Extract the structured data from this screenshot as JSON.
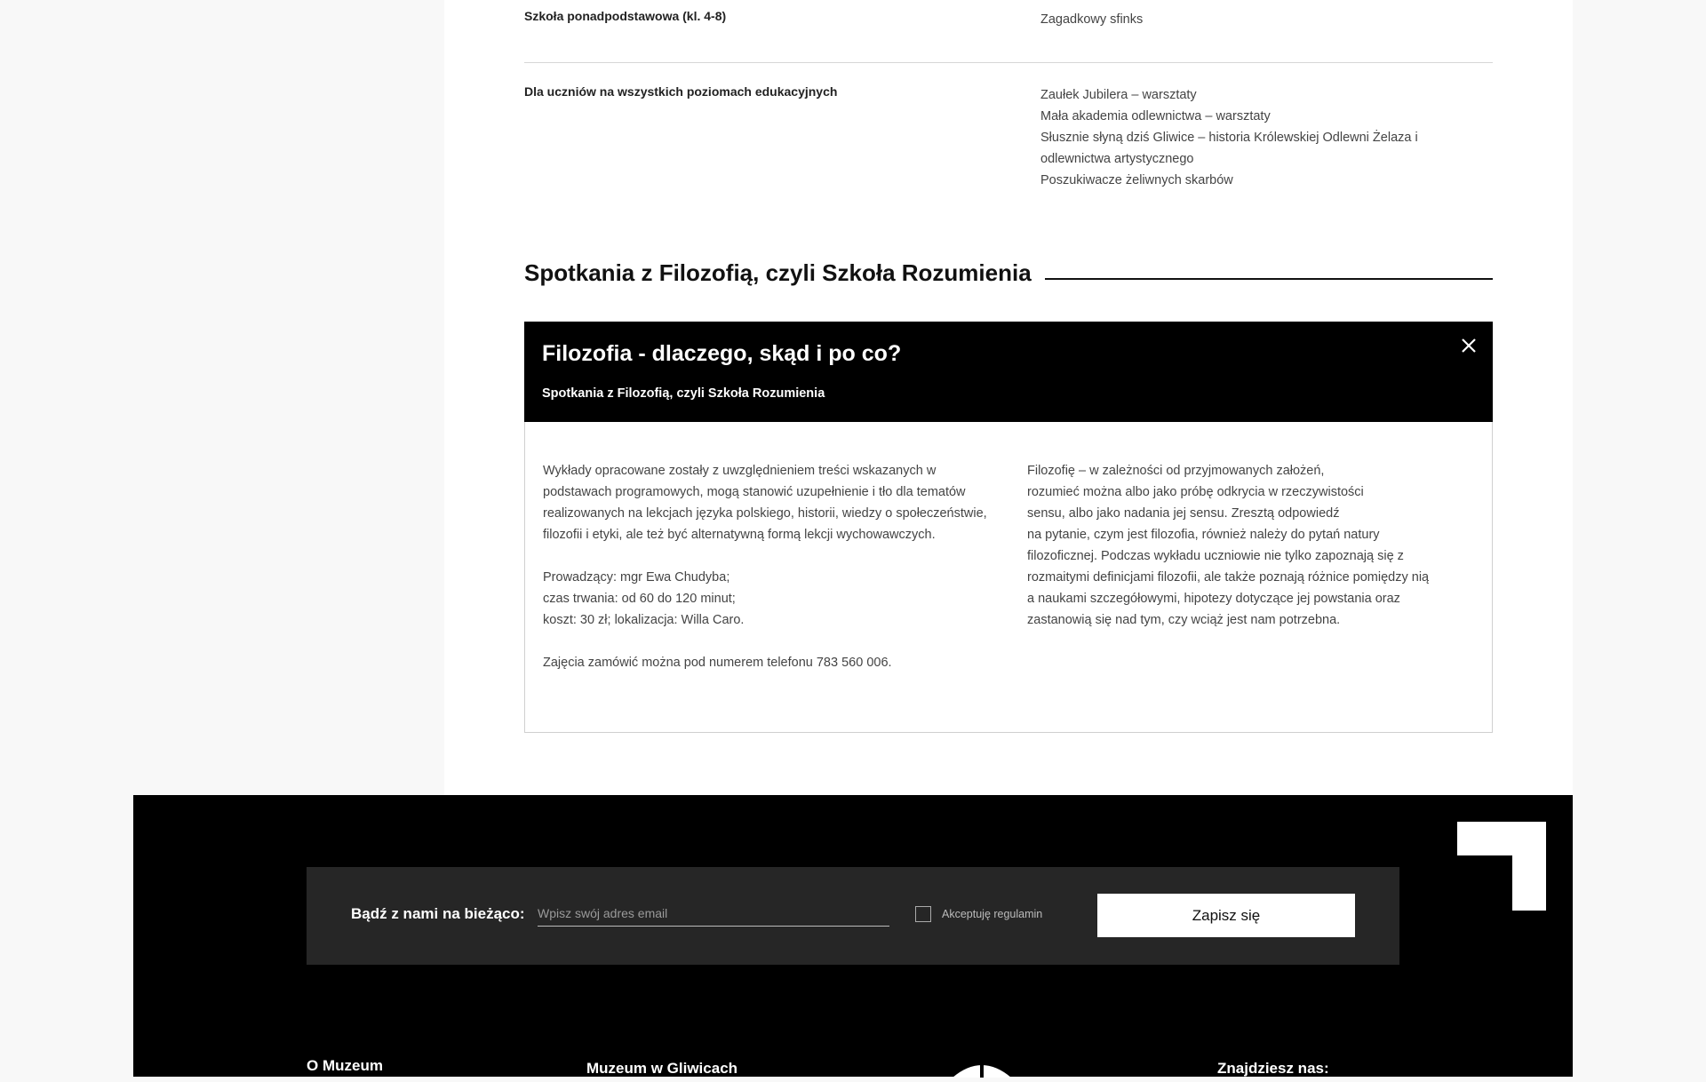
{
  "education_rows": [
    {
      "level": "Szkoła ponadpodstawowa (kl. 4-8)",
      "items": [
        "Zagadkowy sfinks"
      ]
    },
    {
      "level": "Dla uczniów na wszystkich poziomach edukacyjnych",
      "items": [
        "Zaułek Jubilera – warsztaty",
        "Mała akademia odlewnictwa – warsztaty",
        "Słusznie słyną dziś Gliwice – historia Królewskiej Odlewni Żelaza i odlewnictwa artystycznego",
        "Poszukiwacze żeliwnych skarbów"
      ]
    }
  ],
  "section": {
    "title": "Spotkania z Filozofią, czyli Szkoła Rozumienia"
  },
  "card": {
    "title": "Filozofia - dlaczego, skąd i po co?",
    "subtitle": "Spotkania z Filozofią, czyli Szkoła Rozumienia",
    "left_paragraphs": [
      "Wykłady opracowane zostały z uwzględnieniem treści wskazanych w podstawach programowych, mogą stanowić uzupełnienie i tło dla tematów realizowanych na lekcjach języka polskiego, historii, wiedzy o społeczeństwie, filozofii i etyki, ale też być alternatywną formą lekcji wychowawczych."
    ],
    "details": [
      "Prowadzący: mgr Ewa Chudyba;",
      "czas trwania: od 60 do 120 minut;",
      "koszt: 30 zł; lokalizacja: Willa Caro."
    ],
    "contact": "Zajęcia zamówić można pod numerem telefonu 783 560 006.",
    "right_lines": [
      "Filozofię – w zależności od przyjmowanych założeń,",
      "rozumieć można albo jako próbę odkrycia w rzeczywistości",
      "sensu, albo jako nadania jej sensu. Zresztą odpowiedź",
      "na pytanie, czym jest filozofia, również należy do pytań natury",
      "filozoficznej. Podczas wykładu uczniowie nie tylko zapoznają się z",
      "rozmaitymi definicjami filozofii, ale także poznają różnice pomiędzy nią",
      "a naukami szczegółowymi, hipotezy dotyczące jej powstania oraz",
      "zastanowią się nad tym, czy wciąż jest nam potrzebna."
    ],
    "close_icon": "close-icon"
  },
  "newsletter": {
    "label": "Bądź z nami na bieżąco:",
    "email_placeholder": "Wpisz swój adres email",
    "email_value": "",
    "terms_label": "Akceptuję regulamin",
    "terms_checked": false,
    "submit_label": "Zapisz się"
  },
  "footer": {
    "col1": "O Muzeum",
    "col2": "Muzeum w Gliwicach",
    "col4": "Znajdziesz nas:"
  },
  "colors": {
    "page_bg": "#f8f8f8",
    "footer_bg": "#000000",
    "newsletter_bg": "#262626",
    "card_head_bg": "#000000"
  }
}
